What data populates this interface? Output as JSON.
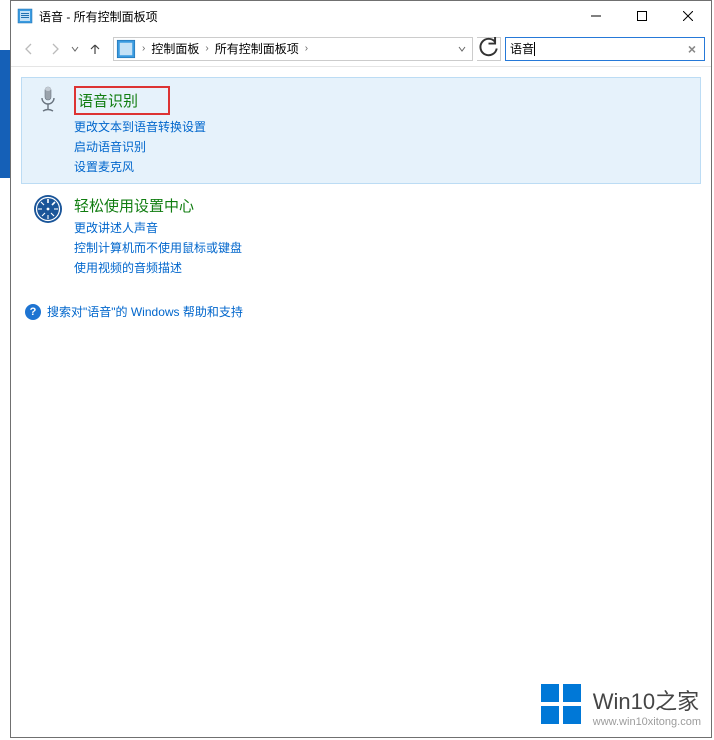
{
  "titlebar": {
    "title": "语音 - 所有控制面板项"
  },
  "breadcrumb": {
    "items": [
      "控制面板",
      "所有控制面板项"
    ]
  },
  "search": {
    "value": "语音",
    "clear": "×"
  },
  "results": [
    {
      "title": "语音识别",
      "highlighted": true,
      "boxed": true,
      "icon": "microphone",
      "links": [
        "更改文本到语音转换设置",
        "启动语音识别",
        "设置麦克风"
      ]
    },
    {
      "title": "轻松使用设置中心",
      "highlighted": false,
      "boxed": false,
      "icon": "ease-of-access",
      "links": [
        "更改讲述人声音",
        "控制计算机而不使用鼠标或键盘",
        "使用视频的音频描述"
      ]
    }
  ],
  "help": {
    "text": "搜索对\"语音\"的 Windows 帮助和支持"
  },
  "watermark": {
    "title_main": "Win10",
    "title_sub": "之家",
    "url": "www.win10xitong.com"
  }
}
